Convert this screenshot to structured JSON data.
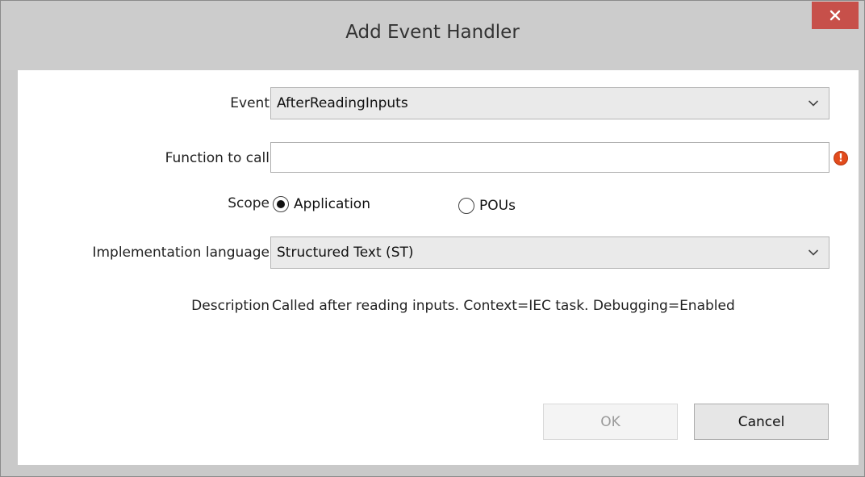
{
  "window": {
    "title": "Add Event Handler",
    "close_symbol": "×"
  },
  "form": {
    "event": {
      "label": "Event",
      "value": "AfterReadingInputs"
    },
    "function_to_call": {
      "label": "Function to call",
      "value": "",
      "error_symbol": "!"
    },
    "scope": {
      "label": "Scope",
      "options": [
        {
          "label": "Application",
          "selected": true
        },
        {
          "label": "POUs",
          "selected": false
        }
      ]
    },
    "implementation_language": {
      "label": "Implementation language",
      "value": "Structured Text (ST)"
    },
    "description": {
      "label": "Description",
      "value": "Called after reading inputs. Context=IEC task. Debugging=Enabled"
    }
  },
  "buttons": {
    "ok_label": "OK",
    "ok_enabled": false,
    "cancel_label": "Cancel"
  },
  "colors": {
    "close_button": "#c7504a",
    "error_icon": "#e24b1c",
    "titlebar": "#cccccc"
  }
}
